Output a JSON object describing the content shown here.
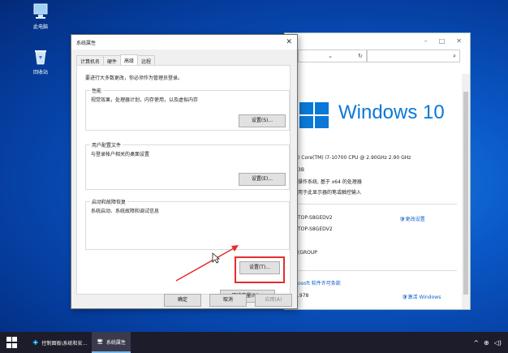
{
  "desktop": {
    "icons": [
      {
        "label": "此电脑",
        "name": "this-pc"
      },
      {
        "label": "回收站",
        "name": "recycle-bin"
      }
    ]
  },
  "control_panel": {
    "window_controls": {
      "minimize": "–",
      "maximize": "□",
      "close": "✕"
    },
    "chevron": "⌄",
    "refresh": "↻",
    "search_glyph": "⌕",
    "os_brand": "Windows",
    "os_version": "10",
    "cpu": ") Core(TM) i7-10700 CPU @ 2.90GHz   2.90 GHz",
    "ram": "3B",
    "system_type": "操作系统, 基于 x64 的处理器",
    "pen_touch": "用于此显示器的笔或触控输入",
    "computer_name": "TOP-S8GEDV2",
    "full_name": "TOP-S8GEDV2",
    "workgroup": "(GROUP",
    "change_settings": "更改设置",
    "license_link": "osoft 软件许可条款",
    "product_id": ".978",
    "activate": "激活 Windows"
  },
  "dialog": {
    "title": "系统属性",
    "close": "✕",
    "tabs": [
      "计算机名",
      "硬件",
      "高级",
      "远程"
    ],
    "active_tab": "高级",
    "admin_note": "要进行大多数更改，你必须作为管理员登录。",
    "performance": {
      "title": "性能",
      "desc": "视觉效果，处理器计划，内存使用，以及虚拟内存",
      "button": "设置(S)..."
    },
    "profiles": {
      "title": "用户配置文件",
      "desc": "与登录帐户相关的桌面设置",
      "button": "设置(E)..."
    },
    "startup": {
      "title": "启动和故障恢复",
      "desc": "系统启动、系统故障和调试信息",
      "button": "设置(T)..."
    },
    "env_button": "环境变量(N)...",
    "ok": "确定",
    "cancel": "取消",
    "apply": "应用(A)"
  },
  "annotation_color": "#e52d2d",
  "taskbar": {
    "items": [
      {
        "label": "控制面板\\系统和安...",
        "name": "control-panel"
      },
      {
        "label": "系统属性",
        "name": "system-properties"
      }
    ],
    "tray": [
      "^",
      "⊕",
      "◁)"
    ]
  }
}
